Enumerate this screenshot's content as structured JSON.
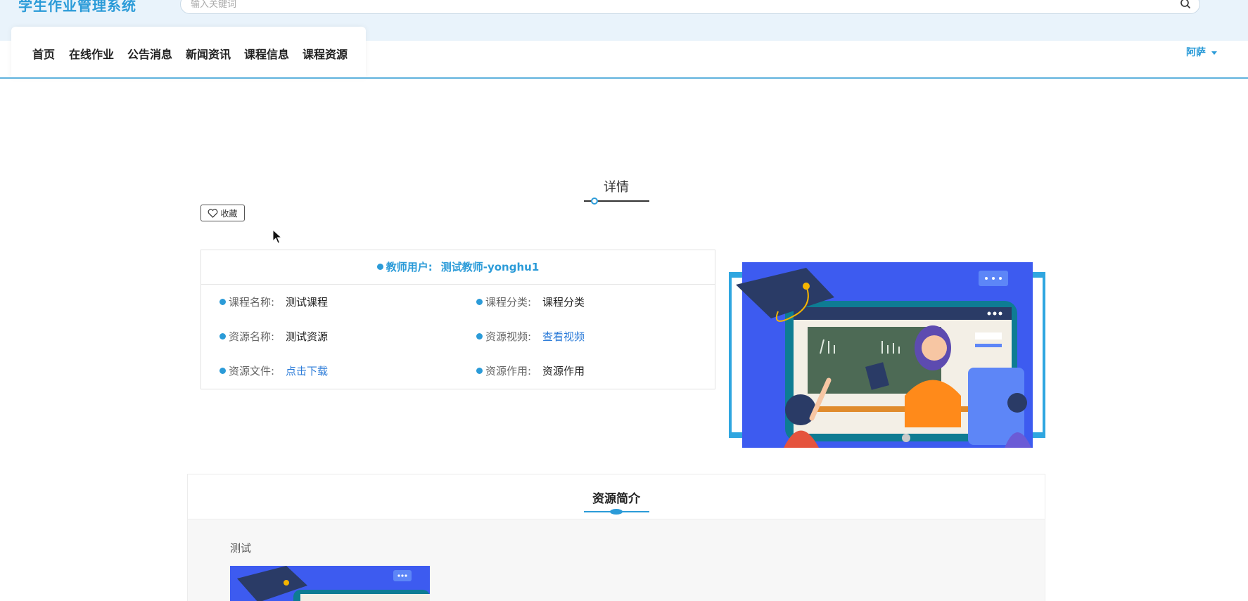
{
  "header": {
    "logo_text": "学生作业管理系统",
    "search_placeholder": "输入关键词",
    "nav": [
      {
        "label": "首页"
      },
      {
        "label": "在线作业"
      },
      {
        "label": "公告消息"
      },
      {
        "label": "新闻资讯"
      },
      {
        "label": "课程信息"
      },
      {
        "label": "课程资源"
      }
    ],
    "user_name": "阿萨"
  },
  "detail": {
    "title": "详情",
    "favorite_label": "收藏",
    "teacher_label": "教师用户:",
    "teacher_value": "测试教师-yonghu1",
    "fields": [
      {
        "label": "课程名称:",
        "value": "测试课程"
      },
      {
        "label": "课程分类:",
        "value": "课程分类"
      },
      {
        "label": "资源名称:",
        "value": "测试资源"
      },
      {
        "label": "资源视频:",
        "value": "查看视频"
      },
      {
        "label": "资源文件:",
        "value": "点击下载"
      },
      {
        "label": "资源作用:",
        "value": "资源作用"
      }
    ]
  },
  "intro": {
    "title": "资源简介",
    "text": "测试"
  },
  "colors": {
    "accent": "#2b9bd8",
    "header_bg": "#e9f3fb",
    "link": "#2b7bd8"
  }
}
